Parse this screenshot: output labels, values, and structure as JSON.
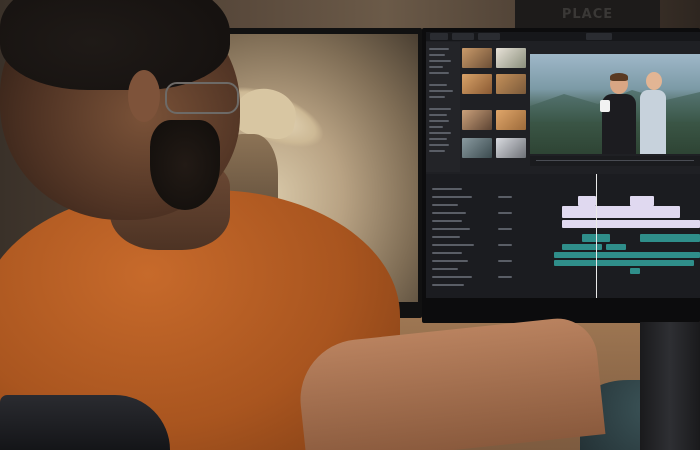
{
  "scene": {
    "wall_sign": "PLACE"
  },
  "colors": {
    "shirt": "#c76a2b",
    "app_background": "#1f2024",
    "clip_light": "#e0d9f0",
    "clip_teal": "#2f8e8a"
  }
}
